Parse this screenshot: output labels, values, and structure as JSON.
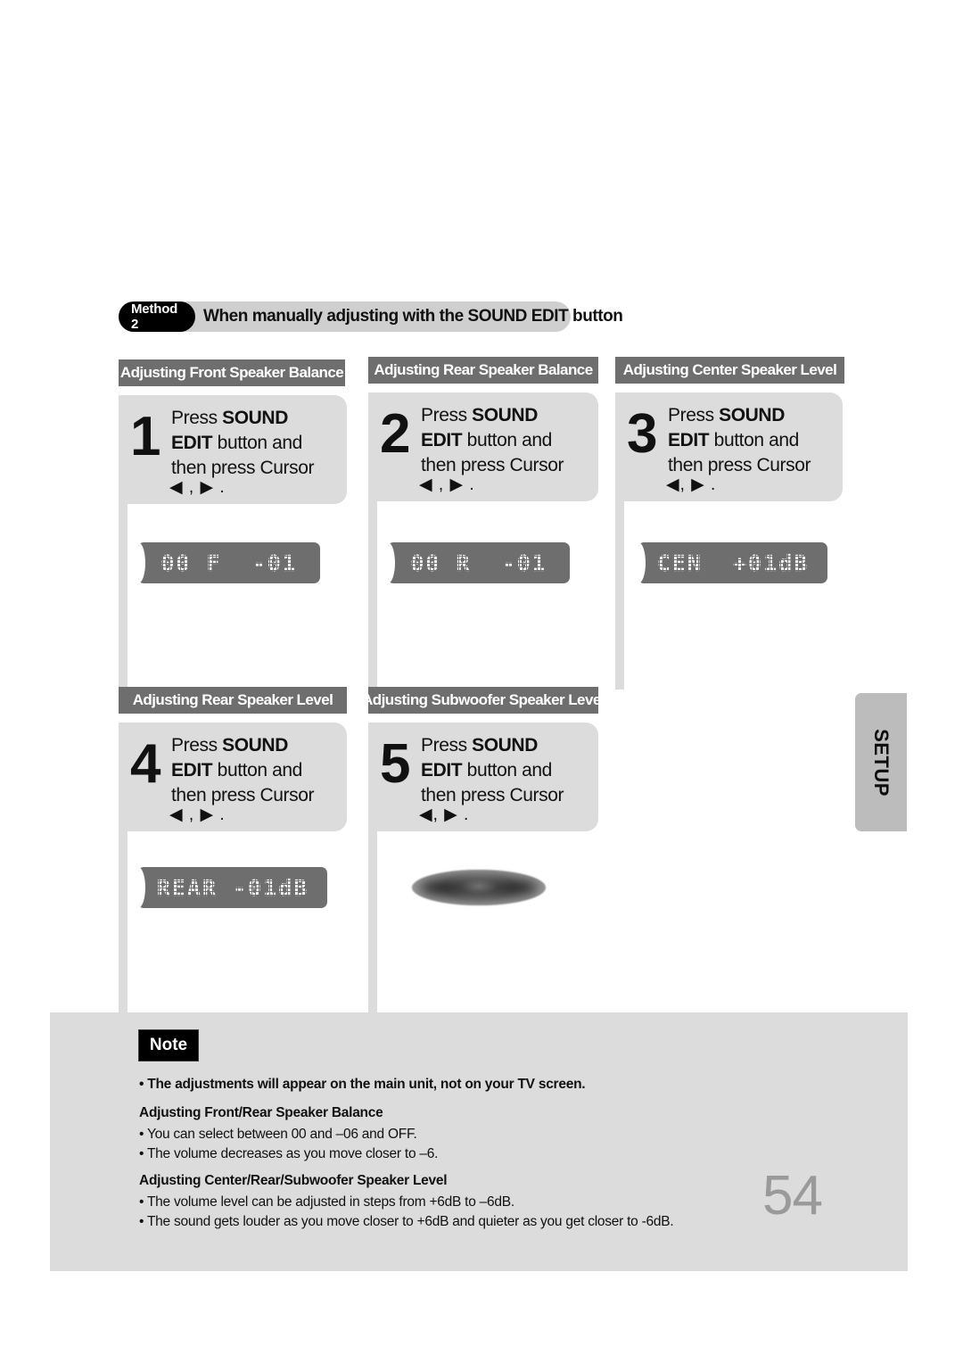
{
  "method": {
    "pill_label": "Method 2",
    "title": "When manually adjusting with the SOUND EDIT button"
  },
  "steps": [
    {
      "header": "Adjusting Front Speaker Balance",
      "number": "1",
      "line1_prefix": "Press ",
      "line1_bold": "SOUND",
      "line2_bold": "EDIT",
      "line2_suffix": " button and",
      "line3": "then press Cursor",
      "cursor": "◀ , ▶ .",
      "display": "00 F  -01"
    },
    {
      "header": "Adjusting Rear Speaker Balance",
      "number": "2",
      "line1_prefix": "Press ",
      "line1_bold": "SOUND",
      "line2_bold": "EDIT",
      "line2_suffix": " button and",
      "line3": "then press Cursor",
      "cursor": "◀ , ▶ .",
      "display": "00 R  -01"
    },
    {
      "header": "Adjusting Center Speaker Level",
      "number": "3",
      "line1_prefix": "Press ",
      "line1_bold": "SOUND",
      "line2_bold": "EDIT",
      "line2_suffix": " button and",
      "line3": "then press Cursor",
      "cursor": "◀, ▶ .",
      "display": "CEN  +01dB"
    },
    {
      "header": "Adjusting Rear Speaker Level",
      "number": "4",
      "line1_prefix": "Press ",
      "line1_bold": "SOUND",
      "line2_bold": "EDIT",
      "line2_suffix": " button and",
      "line3": "then press Cursor",
      "cursor": "◀ , ▶ .",
      "display": "REAR -01dB"
    },
    {
      "header": "Adjusting Subwoofer Speaker Level",
      "number": "5",
      "line1_prefix": "Press ",
      "line1_bold": "SOUND",
      "line2_bold": "EDIT",
      "line2_suffix": " button and",
      "line3": "then press Cursor",
      "cursor": "◀, ▶ .",
      "display": ""
    }
  ],
  "setup_tab": {
    "label": "SETUP"
  },
  "note": {
    "badge": "Note",
    "bullet_main": "• The adjustments will appear on the main unit, not on your TV screen.",
    "section1_title": "Adjusting Front/Rear Speaker Balance",
    "section1_bullet1": "• You can select between 00 and –06 and OFF.",
    "section1_bullet2": "• The volume decreases as you move closer to –6.",
    "section2_title": "Adjusting Center/Rear/Subwoofer Speaker Level",
    "section2_bullet1": "• The volume level can be adjusted in steps from +6dB to –6dB.",
    "section2_bullet2": "• The sound gets louder as you move closer to +6dB and quieter as you get closer to -6dB."
  },
  "page_number": "54",
  "colors": {
    "header_gray": "#6e6e6e",
    "panel_gray": "#dcdcdc",
    "tab_gray": "#bcbcbc",
    "page_number_gray": "#9a9a9a"
  }
}
